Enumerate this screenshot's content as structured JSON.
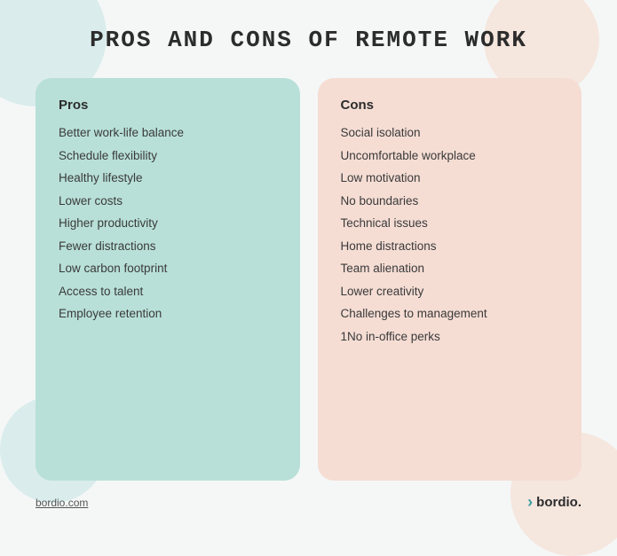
{
  "page": {
    "title": "Pros And Cons of Remote Work",
    "pros_card": {
      "header": "Pros",
      "items": [
        "Better work-life balance",
        "Schedule flexibility",
        "Healthy lifestyle",
        "Lower costs",
        "Higher productivity",
        "Fewer distractions",
        "Low carbon footprint",
        "Access to talent",
        "Employee retention"
      ]
    },
    "cons_card": {
      "header": "Cons",
      "items": [
        "Social isolation",
        "Uncomfortable workplace",
        "Low motivation",
        "No boundaries",
        "Technical issues",
        "Home distractions",
        "Team alienation",
        "Lower creativity",
        "Challenges to management",
        "1No in-office perks"
      ]
    },
    "footer": {
      "link_text": "bordio.com",
      "brand_text": "bordio."
    }
  }
}
